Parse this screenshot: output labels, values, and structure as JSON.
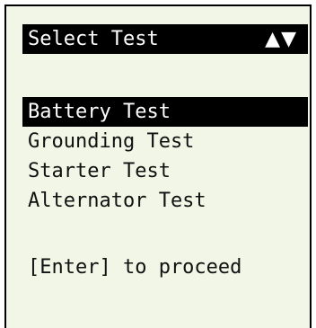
{
  "header": {
    "title": "Select Test",
    "nav_arrows": "▲▼"
  },
  "menu": {
    "items": [
      {
        "label": "Battery Test",
        "selected": true
      },
      {
        "label": "Grounding Test",
        "selected": false
      },
      {
        "label": "Starter Test",
        "selected": false
      },
      {
        "label": "Alternator Test",
        "selected": false
      }
    ]
  },
  "footer": {
    "hint": "[Enter] to proceed"
  },
  "colors": {
    "screen_background": "#f1f6e6",
    "highlight": "#000000",
    "text": "#111111"
  }
}
